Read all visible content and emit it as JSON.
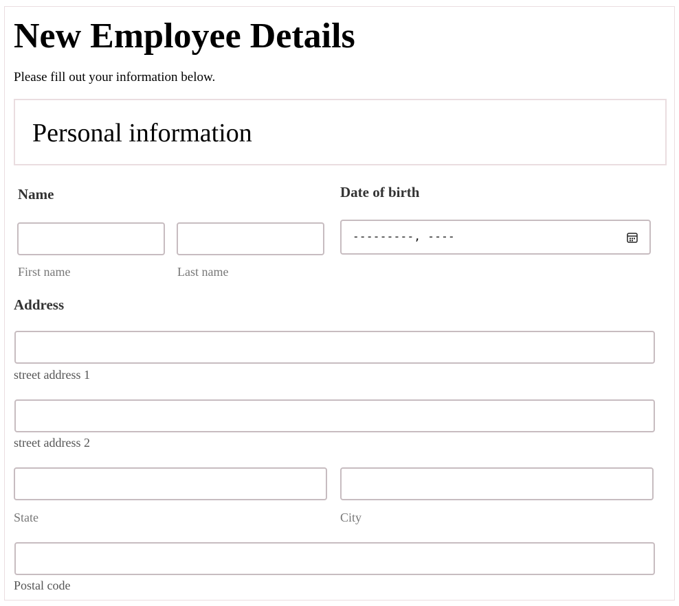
{
  "header": {
    "title": "New Employee Details",
    "subtitle": "Please fill out your information below."
  },
  "personal_section": {
    "title": "Personal information"
  },
  "name": {
    "label": "Name",
    "first_name_value": "",
    "first_name_hint": "First name",
    "last_name_value": "",
    "last_name_hint": "Last name"
  },
  "dob": {
    "label": "Date of birth",
    "placeholder": "---------,  ----",
    "icon": "calendar-icon"
  },
  "address": {
    "label": "Address",
    "street1_value": "",
    "street1_hint": "street address 1",
    "street2_value": "",
    "street2_hint": "street address 2",
    "state_value": "",
    "state_hint": "State",
    "city_value": "",
    "city_hint": "City",
    "postal_value": "",
    "postal_hint": "Postal code"
  }
}
